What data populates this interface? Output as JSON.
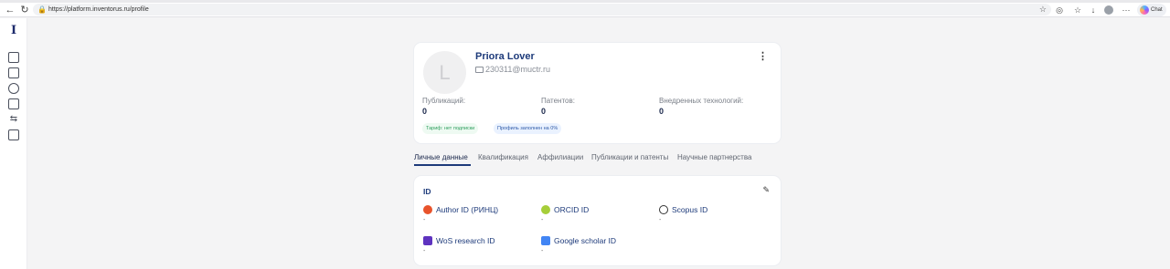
{
  "browser": {
    "url": "https://platform.inventorus.ru/profile",
    "copilot_label": "Chat"
  },
  "profile": {
    "avatar_letter": "L",
    "name": "Priora Lover",
    "email": "230311@muctr.ru",
    "stats": [
      {
        "label": "Публикаций:",
        "value": "0"
      },
      {
        "label": "Патентов:",
        "value": "0"
      },
      {
        "label": "Внедренных технологий:",
        "value": "0"
      }
    ],
    "plan_badge": "Тариф: нет подписки",
    "fill_badge": "Профиль заполнен на 0%",
    "fill_percent": 0
  },
  "tabs": [
    {
      "label": "Личные данные",
      "active": true
    },
    {
      "label": "Квалификация",
      "active": false
    },
    {
      "label": "Аффилиации",
      "active": false
    },
    {
      "label": "Публикации и патенты",
      "active": false
    },
    {
      "label": "Научные партнерства",
      "active": false
    }
  ],
  "ids": {
    "title": "ID",
    "items": [
      {
        "label": "Author ID (РИНЦ)",
        "value": "-",
        "icon": "elibrary-icon",
        "color": "#e8532b"
      },
      {
        "label": "ORCID ID",
        "value": "-",
        "icon": "orcid-icon",
        "color": "#a6ce39"
      },
      {
        "label": "Scopus ID",
        "value": "-",
        "icon": "scopus-icon",
        "color": "#333333"
      },
      {
        "label": "WoS research ID",
        "value": "-",
        "icon": "wos-icon",
        "color": "#5e33bf"
      },
      {
        "label": "Google scholar ID",
        "value": "-",
        "icon": "google-scholar-icon",
        "color": "#4285f4"
      }
    ]
  },
  "colors": {
    "accent": "#1d3a7a",
    "background": "#f4f4f5",
    "card": "#ffffff"
  }
}
